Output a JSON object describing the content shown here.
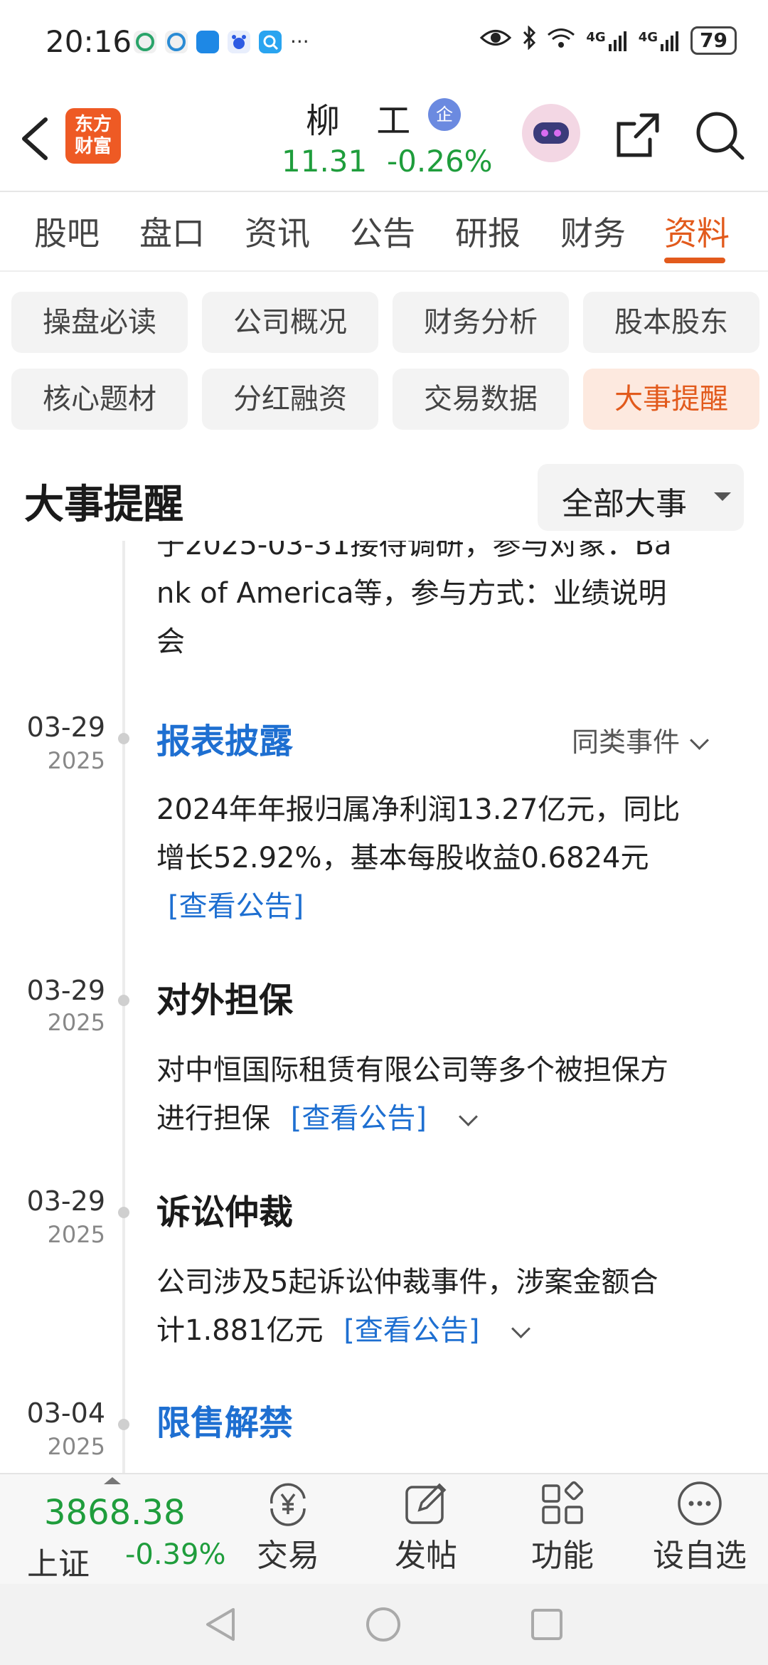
{
  "status_bar": {
    "time": "20:16",
    "more": "···",
    "net1": "4G",
    "net2": "4G",
    "battery": "79",
    "icons": [
      "china-mobile-icon",
      "china-mobile-icon",
      "app-icon",
      "baidu-icon",
      "search-app-icon",
      "eye-icon",
      "bluetooth-icon",
      "wifi-icon",
      "signal-icon",
      "signal-icon",
      "battery-icon"
    ]
  },
  "header": {
    "logo_line1": "东方",
    "logo_line2": "财富",
    "stock_name": "柳 工",
    "badge": "企",
    "price": "11.31",
    "change": "-0.26%",
    "colors": {
      "down": "#1f9d3c",
      "accent": "#e25a1c",
      "brand": "#ee5a24"
    }
  },
  "tabs": [
    {
      "label": "股吧"
    },
    {
      "label": "盘口"
    },
    {
      "label": "资讯"
    },
    {
      "label": "公告"
    },
    {
      "label": "研报"
    },
    {
      "label": "财务"
    },
    {
      "label": "资料",
      "active": true
    }
  ],
  "chips": [
    {
      "label": "操盘必读"
    },
    {
      "label": "公司概况"
    },
    {
      "label": "财务分析"
    },
    {
      "label": "股本股东"
    },
    {
      "label": "核心题材"
    },
    {
      "label": "分红融资"
    },
    {
      "label": "交易数据"
    },
    {
      "label": "大事提醒",
      "active": true
    }
  ],
  "section": {
    "title": "大事提醒",
    "filter": "全部大事"
  },
  "timeline": {
    "partial_top": "于2025-03-31接待调研，参与对象：Ba",
    "partial_line2": "nk of America等，参与方式：业绩说明",
    "partial_line3": "会",
    "events": [
      {
        "date": "03-29",
        "year": "2025",
        "title": "报表披露",
        "same_type": "同类事件",
        "line1": "2024年年报归属净利润13.27亿元，同比",
        "line2": "增长52.92%，基本每股收益0.6824元",
        "link": "[查看公告]"
      },
      {
        "date": "03-29",
        "year": "2025",
        "title": "对外担保",
        "line1": "对中恒国际租赁有限公司等多个被担保方",
        "line2": "进行担保",
        "link": "[查看公告]"
      },
      {
        "date": "03-29",
        "year": "2025",
        "title": "诉讼仲裁",
        "line1": "公司涉及5起诉讼仲裁事件，涉案金额合",
        "line2": "计1.881亿元",
        "link": "[查看公告]"
      },
      {
        "date": "03-04",
        "year": "2025",
        "title": "限售解禁"
      }
    ]
  },
  "bottom_bar": {
    "index_value": "3868.38",
    "index_name": "上证",
    "index_change": "-0.39%",
    "items": [
      {
        "label": "交易",
        "icon": "yen-exchange-icon"
      },
      {
        "label": "发帖",
        "icon": "edit-icon"
      },
      {
        "label": "功能",
        "icon": "grid-icon"
      },
      {
        "label": "设自选",
        "icon": "more-circle-icon"
      }
    ]
  }
}
